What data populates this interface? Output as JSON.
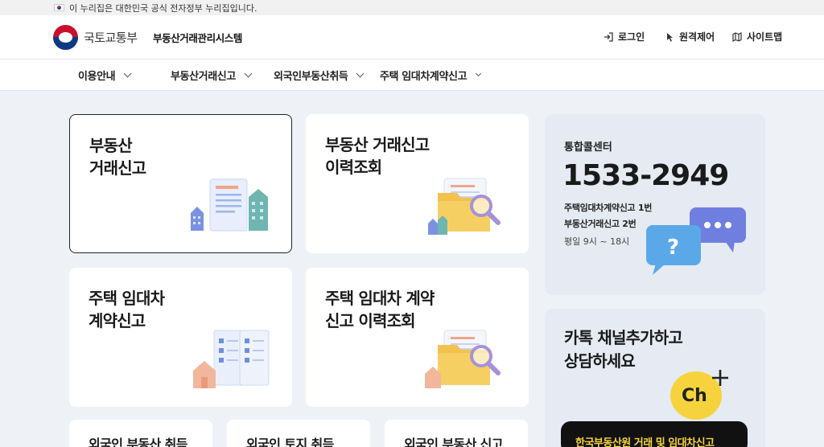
{
  "gov_banner": {
    "text": "이 누리집은 대한민국 공식 전자정부 누리집입니다."
  },
  "header": {
    "ministry": "국토교통부",
    "system_name": "부동산거래관리시스템",
    "utility": [
      {
        "label": "로그인",
        "icon": "login-icon"
      },
      {
        "label": "원격제어",
        "icon": "cursor-icon"
      },
      {
        "label": "사이트맵",
        "icon": "map-icon"
      }
    ]
  },
  "gnb": {
    "items": [
      {
        "label": "이용안내"
      },
      {
        "label": "부동산거래신고"
      },
      {
        "label": "외국인부동산취득"
      },
      {
        "label": "주택 임대차계약신고"
      }
    ]
  },
  "cards": [
    {
      "title": "부동산\n거래신고",
      "illustration": "document-buildings-illustration"
    },
    {
      "title": "부동산 거래신고\n이력조회",
      "illustration": "folder-magnifier-illustration"
    },
    {
      "title": "주택 임대차\n계약신고",
      "illustration": "checklist-house-illustration"
    },
    {
      "title": "주택 임대차 계약\n신고 이력조회",
      "illustration": "folder-magnifier-house-illustration"
    }
  ],
  "call_center": {
    "label": "통합콜센터",
    "number": "1533-2949",
    "line1": "주택임대차계약신고 1번",
    "line2": "부동산거래신고 2번",
    "hours": "평일 9시 ~ 18시",
    "illustration": "speech-bubbles-illustration"
  },
  "kakao": {
    "title": "카톡 채널추가하고\n상담하세요",
    "badge": "Ch",
    "banner": "한국부동산원 거래 및 임대차신고"
  },
  "bottom_cards": [
    {
      "label": "외국인 부동산 취득"
    },
    {
      "label": "외국인 토지 취득"
    },
    {
      "label": "외국인 부동산 신고"
    }
  ],
  "colors": {
    "accent_blue": "#3a74c9",
    "kakao_yellow": "#f6d33c",
    "page_bg": "#eef1f6"
  }
}
